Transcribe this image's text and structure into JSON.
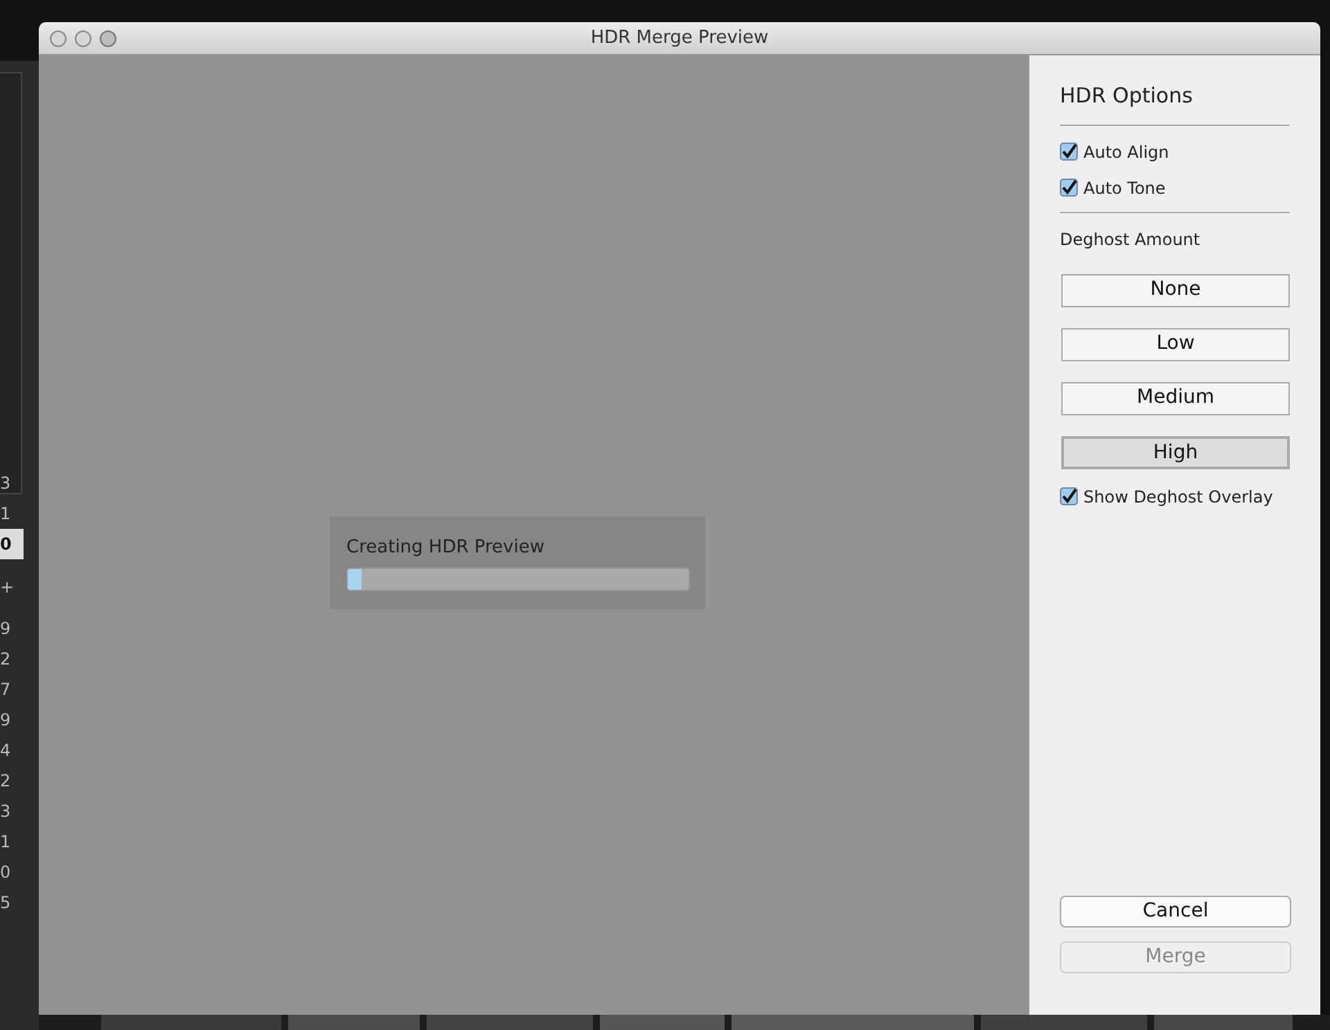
{
  "background_app": {
    "left_column": [
      {
        "text": "3",
        "selected": false
      },
      {
        "text": "1",
        "selected": false
      },
      {
        "text": "0",
        "selected": true
      },
      {
        "text": "+",
        "selected": false
      },
      {
        "text": "9",
        "selected": false
      },
      {
        "text": "2",
        "selected": false
      },
      {
        "text": "7",
        "selected": false
      },
      {
        "text": "9",
        "selected": false
      },
      {
        "text": "4",
        "selected": false
      },
      {
        "text": "2",
        "selected": false
      },
      {
        "text": "3",
        "selected": false
      },
      {
        "text": "1",
        "selected": false
      },
      {
        "text": "0",
        "selected": false
      },
      {
        "text": "5",
        "selected": false
      }
    ]
  },
  "window": {
    "title": "HDR Merge Preview"
  },
  "progress": {
    "label": "Creating HDR Preview",
    "level": 0.04
  },
  "options": {
    "title": "HDR Options",
    "checkboxes": [
      {
        "label": "Auto Align",
        "checked": true
      },
      {
        "label": "Auto Tone",
        "checked": true
      }
    ],
    "deghost_label": "Deghost Amount",
    "deghost_options": [
      {
        "label": "None",
        "selected": false
      },
      {
        "label": "Low",
        "selected": false
      },
      {
        "label": "Medium",
        "selected": false
      },
      {
        "label": "High",
        "selected": true
      }
    ],
    "overlay": {
      "label": "Show Deghost Overlay",
      "checked": true
    }
  },
  "buttons": [
    {
      "label": "Cancel",
      "disabled": false
    },
    {
      "label": "Merge",
      "disabled": true
    }
  ]
}
